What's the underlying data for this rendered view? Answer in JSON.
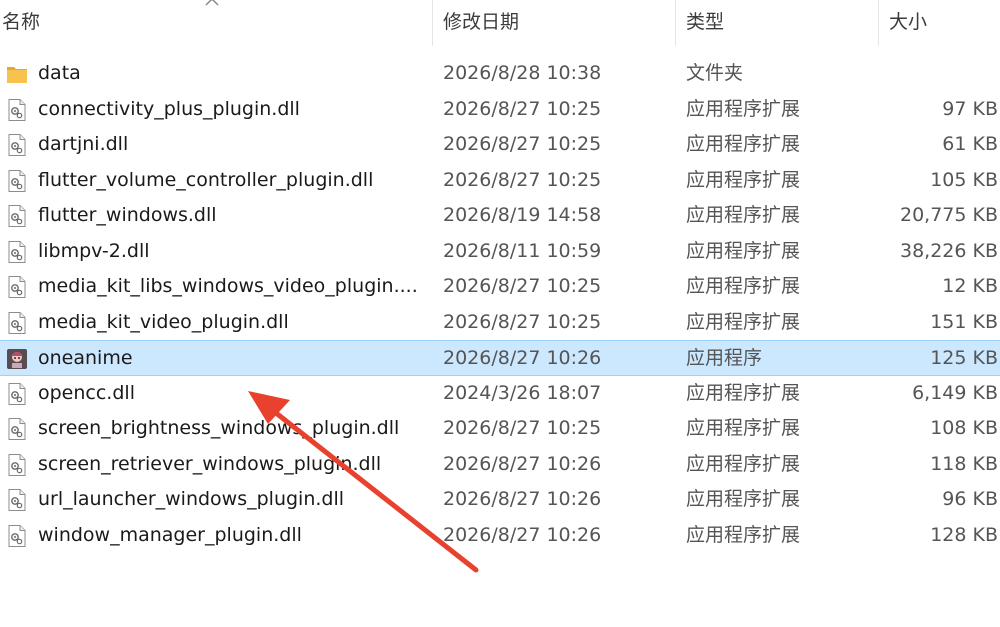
{
  "columns": {
    "name": "名称",
    "date": "修改日期",
    "type": "类型",
    "size": "大小"
  },
  "files": [
    {
      "name": "data",
      "date": "2026/8/28 10:38",
      "type": "文件夹",
      "size": "",
      "icon": "folder-icon"
    },
    {
      "name": "connectivity_plus_plugin.dll",
      "date": "2026/8/27 10:25",
      "type": "应用程序扩展",
      "size": "97 KB",
      "icon": "dll-file-icon"
    },
    {
      "name": "dartjni.dll",
      "date": "2026/8/27 10:25",
      "type": "应用程序扩展",
      "size": "61 KB",
      "icon": "dll-file-icon"
    },
    {
      "name": "flutter_volume_controller_plugin.dll",
      "date": "2026/8/27 10:25",
      "type": "应用程序扩展",
      "size": "105 KB",
      "icon": "dll-file-icon"
    },
    {
      "name": "flutter_windows.dll",
      "date": "2026/8/19 14:58",
      "type": "应用程序扩展",
      "size": "20,775 KB",
      "icon": "dll-file-icon"
    },
    {
      "name": "libmpv-2.dll",
      "date": "2026/8/11 10:59",
      "type": "应用程序扩展",
      "size": "38,226 KB",
      "icon": "dll-file-icon"
    },
    {
      "name": "media_kit_libs_windows_video_plugin....",
      "date": "2026/8/27 10:25",
      "type": "应用程序扩展",
      "size": "12 KB",
      "icon": "dll-file-icon"
    },
    {
      "name": "media_kit_video_plugin.dll",
      "date": "2026/8/27 10:25",
      "type": "应用程序扩展",
      "size": "151 KB",
      "icon": "dll-file-icon"
    },
    {
      "name": "oneanime",
      "date": "2026/8/27 10:26",
      "type": "应用程序",
      "size": "125 KB",
      "icon": "app-icon",
      "selected": true
    },
    {
      "name": "opencc.dll",
      "date": "2024/3/26 18:07",
      "type": "应用程序扩展",
      "size": "6,149 KB",
      "icon": "dll-file-icon"
    },
    {
      "name": "screen_brightness_windows_plugin.dll",
      "date": "2026/8/27 10:25",
      "type": "应用程序扩展",
      "size": "108 KB",
      "icon": "dll-file-icon"
    },
    {
      "name": "screen_retriever_windows_plugin.dll",
      "date": "2026/8/27 10:26",
      "type": "应用程序扩展",
      "size": "118 KB",
      "icon": "dll-file-icon"
    },
    {
      "name": "url_launcher_windows_plugin.dll",
      "date": "2026/8/27 10:26",
      "type": "应用程序扩展",
      "size": "96 KB",
      "icon": "dll-file-icon"
    },
    {
      "name": "window_manager_plugin.dll",
      "date": "2026/8/27 10:26",
      "type": "应用程序扩展",
      "size": "128 KB",
      "icon": "dll-file-icon"
    }
  ],
  "colors": {
    "selection_bg": "#cce8ff",
    "selection_border": "#99d1ff",
    "folder": "#f8c24f",
    "annotation_arrow": "#e8412e"
  }
}
